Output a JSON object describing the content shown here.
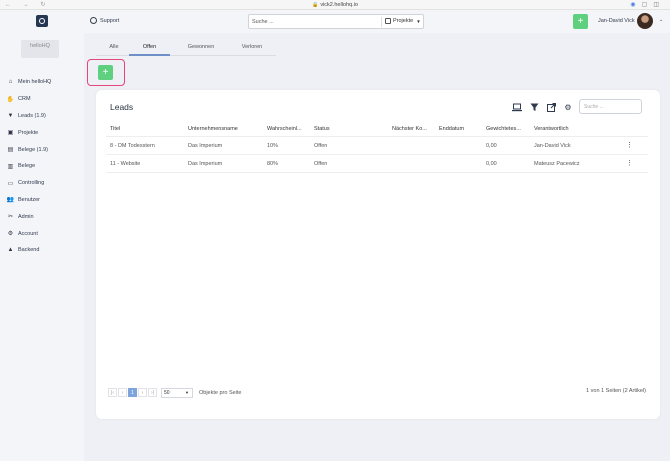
{
  "browser": {
    "url": "vick2.hellohq.io",
    "nav_glyphs": "← → ↻"
  },
  "sidebar": {
    "brand": "helloHQ",
    "items": [
      {
        "label": "Mein helloHQ",
        "icon": "house-icon",
        "glyph": "⌂"
      },
      {
        "label": "CRM",
        "icon": "handshake-icon",
        "glyph": "✋"
      },
      {
        "label": "Leads (1.9)",
        "icon": "funnel-icon",
        "glyph": "▼"
      },
      {
        "label": "Projekte",
        "icon": "folder-icon",
        "glyph": "▣"
      },
      {
        "label": "Belege (1.9)",
        "icon": "receipt-icon",
        "glyph": "▤"
      },
      {
        "label": "Belege",
        "icon": "document-icon",
        "glyph": "▥"
      },
      {
        "label": "Controlling",
        "icon": "monitor-icon",
        "glyph": "▭"
      },
      {
        "label": "Benutzer",
        "icon": "users-icon",
        "glyph": "👥"
      },
      {
        "label": "Admin",
        "icon": "tools-icon",
        "glyph": "✂"
      },
      {
        "label": "Account",
        "icon": "gear-icon",
        "glyph": "⚙"
      },
      {
        "label": "Backend",
        "icon": "bank-icon",
        "glyph": "▲"
      }
    ]
  },
  "topbar": {
    "support_label": "Support",
    "search_placeholder": "Suche ...",
    "scope_label": "Projekte",
    "add_label": "+",
    "user_name": "Jan-David Vick"
  },
  "tabs": [
    "Alle",
    "Offen",
    "Gewonnen",
    "Verloren"
  ],
  "active_tab": "Offen",
  "add_button_label": "+",
  "card": {
    "title": "Leads",
    "search_placeholder": "Suche ...",
    "columns": [
      "Titel",
      "Unternehmensname",
      "Wahrscheinl...",
      "Status",
      "Nächster Ko...",
      "Enddatum",
      "Gewichtetes...",
      "Verantwortlich"
    ],
    "rows": [
      [
        "8 - DM Todesstern",
        "Das Imperium",
        "10%",
        "Offen",
        "",
        "",
        "0,00",
        "Jan-David Vick"
      ],
      [
        "11 - Website",
        "Das Imperium",
        "80%",
        "Offen",
        "",
        "",
        "0,00",
        "Mateusz Pacewicz"
      ]
    ],
    "pager": {
      "first": "|‹",
      "prev": "‹",
      "current": "1",
      "next": "›",
      "last": "›|",
      "per_page": "50",
      "per_page_label": "Objekte pro Seite",
      "info": "1 von 1 Seiten (2 Artikel)"
    }
  },
  "colors": {
    "accent_green": "#5ed07f",
    "highlight_pink": "#e34878",
    "active_tab_line": "#6e8fc8",
    "pager_active": "#7ea4dc"
  }
}
